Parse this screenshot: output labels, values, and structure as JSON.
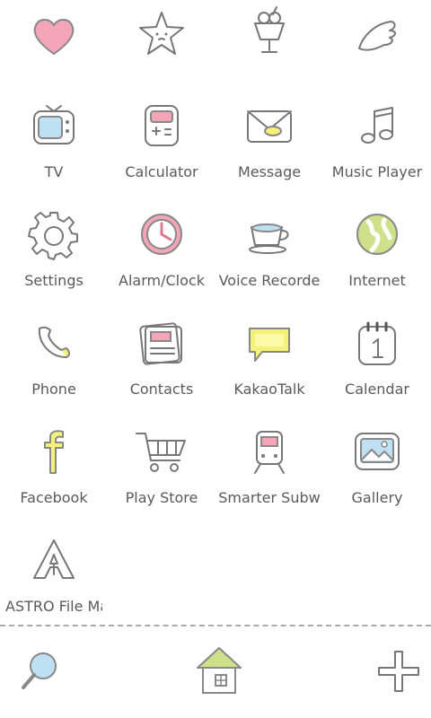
{
  "top_row": [
    {
      "icon": "heart-icon"
    },
    {
      "icon": "star-icon"
    },
    {
      "icon": "parfait-icon"
    },
    {
      "icon": "wing-icon"
    }
  ],
  "apps": [
    {
      "label": "TV",
      "icon": "tv-icon"
    },
    {
      "label": "Calculator",
      "icon": "calculator-icon"
    },
    {
      "label": "Message",
      "icon": "envelope-icon"
    },
    {
      "label": "Music Player",
      "icon": "music-note-icon"
    },
    {
      "label": "Settings",
      "icon": "gear-icon"
    },
    {
      "label": "Alarm/Clock",
      "icon": "clock-icon"
    },
    {
      "label": "Voice Recorde",
      "icon": "teacup-icon"
    },
    {
      "label": "Internet",
      "icon": "globe-icon"
    },
    {
      "label": "Phone",
      "icon": "phone-icon"
    },
    {
      "label": "Contacts",
      "icon": "address-book-icon"
    },
    {
      "label": "KakaoTalk",
      "icon": "speech-bubble-icon"
    },
    {
      "label": "Calendar",
      "icon": "calendar-icon"
    },
    {
      "label": "Facebook",
      "icon": "facebook-icon"
    },
    {
      "label": "Play Store",
      "icon": "shopping-cart-icon"
    },
    {
      "label": "Smarter Subw",
      "icon": "subway-icon"
    },
    {
      "label": "Gallery",
      "icon": "picture-icon"
    },
    {
      "label": "ASTRO File Ma",
      "icon": "astro-icon"
    }
  ],
  "dock": {
    "search": "search-icon",
    "home": "home-icon",
    "add": "plus-icon"
  },
  "colors": {
    "pink": "#f4a6b8",
    "blue": "#bfe0f2",
    "yellow": "#f5f27a",
    "green": "#cfe08a",
    "outline": "#777777",
    "label": "#5a5a5a"
  }
}
